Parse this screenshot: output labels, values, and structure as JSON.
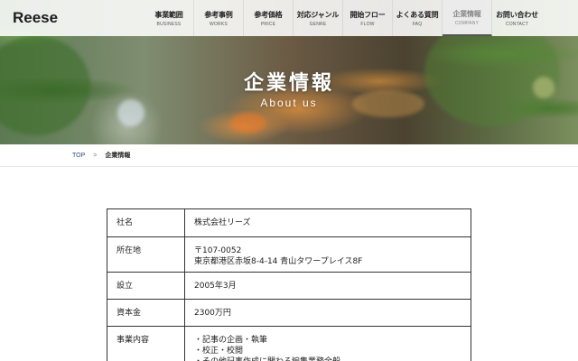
{
  "header": {
    "logo": "Reese",
    "nav": [
      {
        "label": "事業範囲",
        "sub": "BUSINESS",
        "active": false
      },
      {
        "label": "参考事例",
        "sub": "WORKS",
        "active": false
      },
      {
        "label": "参考価格",
        "sub": "PRICE",
        "active": false
      },
      {
        "label": "対応ジャンル",
        "sub": "GENRE",
        "active": false
      },
      {
        "label": "開始フロー",
        "sub": "FLOW",
        "active": false
      },
      {
        "label": "よくある質問",
        "sub": "FAQ",
        "active": false
      },
      {
        "label": "企業情報",
        "sub": "COMPANY",
        "active": true
      },
      {
        "label": "お問い合わせ",
        "sub": "CONTACT",
        "active": false
      }
    ]
  },
  "hero": {
    "title": "企業情報",
    "subtitle": "About us"
  },
  "breadcrumb": {
    "top": "TOP",
    "separator": ">",
    "current": "企業情報"
  },
  "company_table": [
    {
      "label": "社名",
      "value": "株式会社リーズ"
    },
    {
      "label": "所在地",
      "value": "〒107-0052\n東京都港区赤坂8-4-14 青山タワープレイス8F"
    },
    {
      "label": "設立",
      "value": "2005年3月"
    },
    {
      "label": "資本金",
      "value": "2300万円"
    },
    {
      "label": "事業内容",
      "value": "・記事の企画・執筆\n・校正・校閲\n・その他記事作成に関わる編集業務全般"
    }
  ]
}
